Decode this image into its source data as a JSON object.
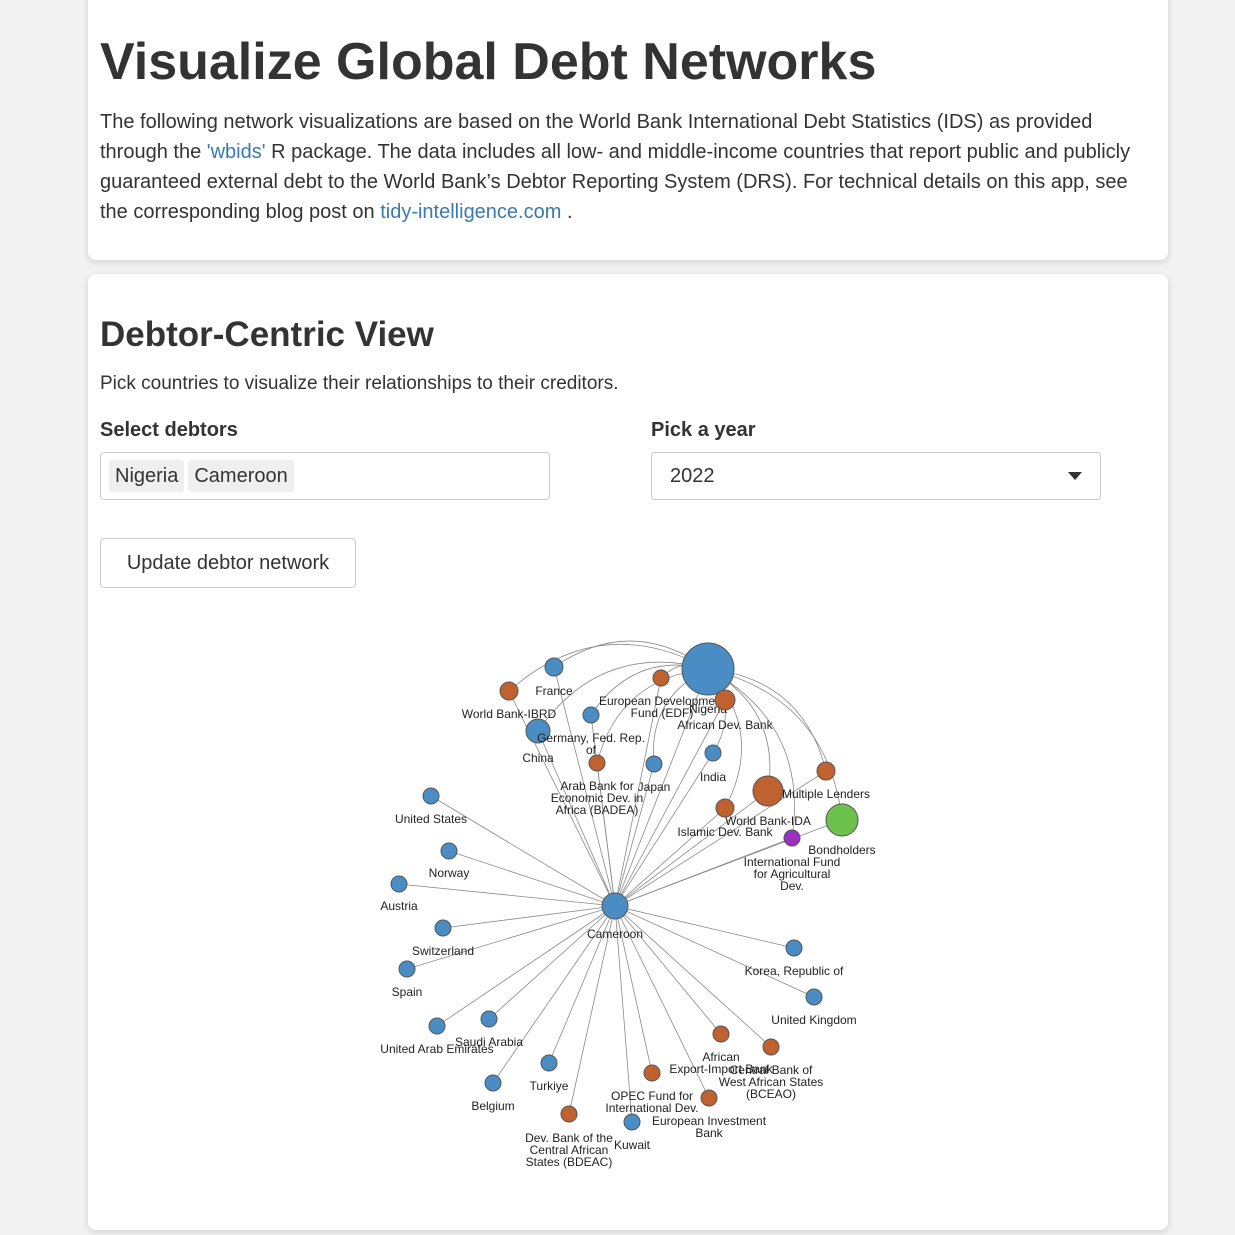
{
  "header": {
    "title": "Visualize Global Debt Networks",
    "intro_part1": "The following network visualizations are based on the World Bank International Debt Statistics (IDS) as provided through the ",
    "wbids_link": "'wbids'",
    "intro_part2": " R package. The data includes all low- and middle-income countries that report public and publicly guaranteed external debt to the World Bank’s Debtor Reporting System (DRS). For technical details on this app, see the corresponding blog post on ",
    "blog_link": "tidy-intelligence.com",
    "intro_part3": " ."
  },
  "debtor_view": {
    "title": "Debtor-Centric View",
    "subtitle": "Pick countries to visualize their relationships to their creditors.",
    "select_debtors_label": "Select debtors",
    "selected_debtors": [
      "Nigeria",
      "Cameroon"
    ],
    "year_label": "Pick a year",
    "year_value": "2022",
    "update_button": "Update debtor network"
  },
  "colors": {
    "country": "#4a8dc4",
    "institution": "#c0622f",
    "bondholders": "#6cc24a",
    "other": "#9b2fc0",
    "link": "#8a8a8a",
    "accent_link": "#3b7ab0"
  },
  "network": {
    "debtors": [
      "Nigeria",
      "Cameroon"
    ],
    "nodes": [
      {
        "id": "Nigeria",
        "label": "Nigeria",
        "type": "country"
      },
      {
        "id": "Cameroon",
        "label": "Cameroon",
        "type": "country"
      },
      {
        "id": "France",
        "label": "France",
        "type": "country"
      },
      {
        "id": "WB-IBRD",
        "label": "World Bank-IBRD",
        "type": "institution"
      },
      {
        "id": "EDF",
        "label": "European Development\nFund (EDF)",
        "type": "institution"
      },
      {
        "id": "AfDB",
        "label": "African Dev. Bank",
        "type": "institution"
      },
      {
        "id": "China",
        "label": "China",
        "type": "country"
      },
      {
        "id": "Germany",
        "label": "Germany, Fed. Rep.\nof",
        "type": "country"
      },
      {
        "id": "Japan",
        "label": "Japan",
        "type": "country"
      },
      {
        "id": "BADEA",
        "label": "Arab Bank for\nEconomic Dev. in\nAfrica (BADEA)",
        "type": "institution"
      },
      {
        "id": "India",
        "label": "India",
        "type": "country"
      },
      {
        "id": "WB-IDA",
        "label": "World Bank-IDA",
        "type": "institution"
      },
      {
        "id": "IsDB",
        "label": "Islamic Dev. Bank",
        "type": "institution"
      },
      {
        "id": "Multiple",
        "label": "Multiple Lenders",
        "type": "institution"
      },
      {
        "id": "Bondholders",
        "label": "Bondholders",
        "type": "bondholders"
      },
      {
        "id": "IFAD",
        "label": "International Fund\nfor Agricultural\nDev.",
        "type": "other"
      },
      {
        "id": "US",
        "label": "United States",
        "type": "country"
      },
      {
        "id": "Norway",
        "label": "Norway",
        "type": "country"
      },
      {
        "id": "Austria",
        "label": "Austria",
        "type": "country"
      },
      {
        "id": "Switzerland",
        "label": "Switzerland",
        "type": "country"
      },
      {
        "id": "Spain",
        "label": "Spain",
        "type": "country"
      },
      {
        "id": "UAE",
        "label": "United Arab Emirates",
        "type": "country"
      },
      {
        "id": "Saudi",
        "label": "Saudi Arabia",
        "type": "country"
      },
      {
        "id": "Belgium",
        "label": "Belgium",
        "type": "country"
      },
      {
        "id": "Turkiye",
        "label": "Turkiye",
        "type": "country"
      },
      {
        "id": "BDEAC",
        "label": "Dev. Bank of the\nCentral African\nStates (BDEAC)",
        "type": "institution"
      },
      {
        "id": "Kuwait",
        "label": "Kuwait",
        "type": "country"
      },
      {
        "id": "OPEC",
        "label": "OPEC Fund for\nInternational Dev.",
        "type": "institution"
      },
      {
        "id": "AfrExim",
        "label": "African\nExport-Import Bank",
        "type": "institution"
      },
      {
        "id": "EIB",
        "label": "European Investment\nBank",
        "type": "institution"
      },
      {
        "id": "BCEAO",
        "label": "Central Bank of\nWest African States\n(BCEAO)",
        "type": "institution"
      },
      {
        "id": "UK",
        "label": "United Kingdom",
        "type": "country"
      },
      {
        "id": "Korea",
        "label": "Korea, Republic of",
        "type": "country"
      }
    ]
  }
}
